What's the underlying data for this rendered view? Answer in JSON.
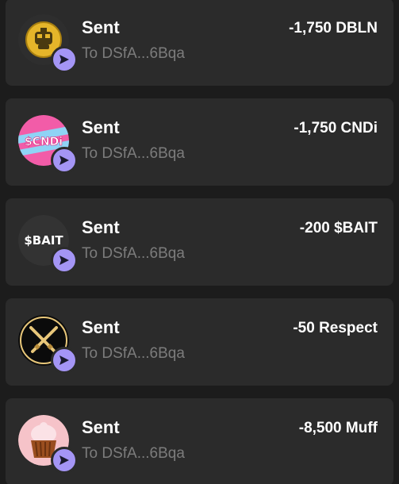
{
  "transactions": [
    {
      "title": "Sent",
      "recipient": "To DSfA...6Bqa",
      "amount": "-1,750 DBLN",
      "token_icon": "dbln-token-icon"
    },
    {
      "title": "Sent",
      "recipient": "To DSfA...6Bqa",
      "amount": "-1,750 CNDi",
      "token_icon": "cndi-token-icon",
      "icon_text": "$CNDi"
    },
    {
      "title": "Sent",
      "recipient": "To DSfA...6Bqa",
      "amount": "-200 $BAIT",
      "token_icon": "bait-token-icon",
      "icon_text": "$BAIT"
    },
    {
      "title": "Sent",
      "recipient": "To DSfA...6Bqa",
      "amount": "-50 Respect",
      "token_icon": "respect-token-icon"
    },
    {
      "title": "Sent",
      "recipient": "To DSfA...6Bqa",
      "amount": "-8,500 Muff",
      "token_icon": "muff-token-icon"
    }
  ],
  "colors": {
    "background": "#1c1c1c",
    "card": "#2b2b2b",
    "badge": "#a495f5",
    "subtitle": "#7c7c7c"
  }
}
